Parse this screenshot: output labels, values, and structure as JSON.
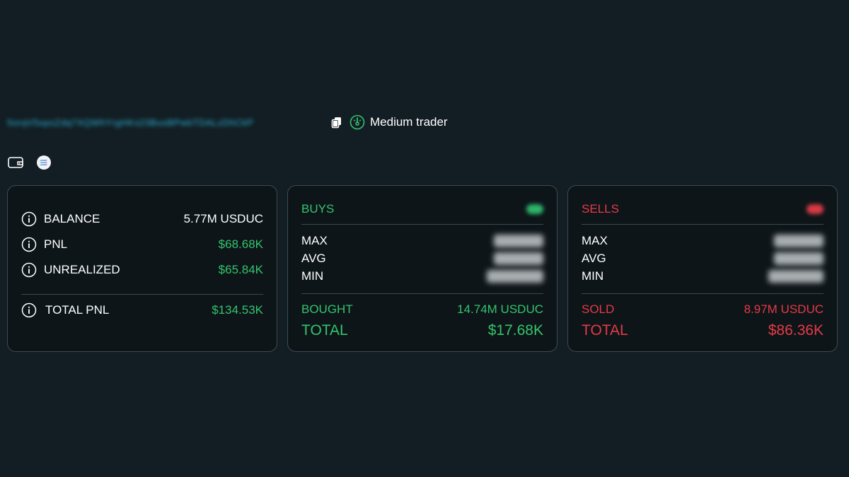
{
  "header": {
    "wallet_address": "5orqV5opsZdq7XQWhYrgHKs23BusBPwbTDALzDhCkP",
    "trader_type": "Medium trader",
    "icons": {
      "copy": "copy-icon",
      "trader": "gauge-icon"
    }
  },
  "toolbar": {
    "icons": [
      "wallet-icon",
      "solana-icon"
    ]
  },
  "balance_card": {
    "rows": [
      {
        "label": "BALANCE",
        "value": "5.77M USDUC"
      },
      {
        "label": "PNL",
        "value": "$68.68K"
      },
      {
        "label": "UNREALIZED",
        "value": "$65.84K"
      }
    ],
    "total": {
      "label": "TOTAL PNL",
      "value": "$134.53K"
    }
  },
  "buys_card": {
    "title": "BUYS",
    "stats": [
      "MAX",
      "AVG",
      "MIN"
    ],
    "summary": {
      "label": "BOUGHT",
      "value": "14.74M USDUC"
    },
    "total": {
      "label": "TOTAL",
      "value": "$17.68K"
    }
  },
  "sells_card": {
    "title": "SELLS",
    "stats": [
      "MAX",
      "AVG",
      "MIN"
    ],
    "summary": {
      "label": "SOLD",
      "value": "8.97M USDUC"
    },
    "total": {
      "label": "TOTAL",
      "value": "$86.36K"
    }
  },
  "colors": {
    "background": "#131e24",
    "card": "#0d1519",
    "positive": "#35c46c",
    "negative": "#e53a45",
    "address": "#2bb3d6"
  }
}
